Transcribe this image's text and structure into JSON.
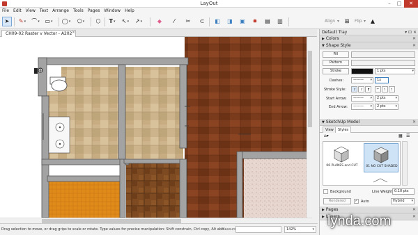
{
  "window": {
    "title": "LayOut"
  },
  "menu": [
    "File",
    "Edit",
    "View",
    "Text",
    "Arrange",
    "Tools",
    "Pages",
    "Window",
    "Help"
  ],
  "toolbar": {
    "tools": [
      {
        "name": "select-tool",
        "icon": "arrow-icon"
      },
      {
        "name": "line-tool",
        "icon": "pencil-icon"
      },
      {
        "name": "arc-tool",
        "icon": "arc-icon"
      },
      {
        "name": "rectangle-tool",
        "icon": "rectangle-icon"
      },
      {
        "name": "circle-tool",
        "icon": "circle-icon"
      },
      {
        "name": "polygon-tool",
        "icon": "polygon-icon"
      },
      {
        "name": "text-tool",
        "icon": "text-icon"
      },
      {
        "name": "label-tool",
        "icon": "label-icon"
      },
      {
        "name": "dimension-tool",
        "icon": "dimension-icon"
      },
      {
        "name": "eraser-tool",
        "icon": "eraser-icon"
      },
      {
        "name": "style-tool",
        "icon": "eyedropper-icon"
      },
      {
        "name": "split-tool",
        "icon": "split-icon"
      },
      {
        "name": "join-tool",
        "icon": "join-icon"
      },
      {
        "name": "scissors-tool",
        "icon": "scissors-icon"
      },
      {
        "name": "page-tool",
        "icon": "page-icon"
      },
      {
        "name": "present-tool",
        "icon": "presentation-icon"
      }
    ],
    "align_label": "Align",
    "flip_label": "Flip"
  },
  "document": {
    "tab_title": "CH09-02 Raster v Vector - A202",
    "close": "×"
  },
  "status": {
    "message": "Drag selection to move, or drag grips to scale or rotate. Type values for precise manipulation: Shift constrain, Ctrl copy, Alt abo...",
    "measurements_label": "Measurements",
    "measurements_value": "",
    "zoom": "142%"
  },
  "tray": {
    "title": "Default Tray",
    "panels": {
      "colors": "Colors",
      "shape_style": "Shape Style",
      "sketchup_model": "SketchUp Model",
      "pages": "Pages",
      "layers": "Layers"
    },
    "shape_style": {
      "fill": "Fill",
      "pattern": "Pattern",
      "stroke": "Stroke",
      "stroke_width": "1 pts",
      "dashes_label": "Dashes:",
      "dash_size": "1x",
      "stroke_style_label": "Stroke Style:",
      "start_arrow_label": "Start Arrow:",
      "start_arrow_size": "2 pts",
      "end_arrow_label": "End Arrow:",
      "end_arrow_size": "2 pts"
    },
    "sketchup": {
      "tabs": [
        "View",
        "Styles"
      ],
      "active_tab": "Styles",
      "styles": [
        "06 PLANES and CUT",
        "01 NO CUT SHADED"
      ],
      "background_label": "Background",
      "line_weight_label": "Line Weight",
      "line_weight": "0.10 pts",
      "rendered_label": "Rendered",
      "auto_label": "Auto",
      "render_mode": "Hybrid"
    }
  },
  "watermark": "lynda.com",
  "colors": {
    "accent": "#3c7fc0",
    "wood": "#7a3a1c",
    "stone": "#cdb48d",
    "orange_tile": "#e08a1a"
  }
}
